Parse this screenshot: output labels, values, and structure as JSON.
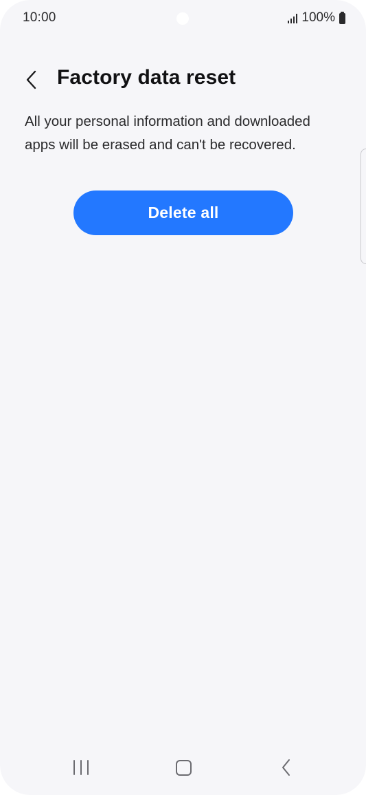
{
  "status_bar": {
    "time": "10:00",
    "battery": "100%"
  },
  "header": {
    "title": "Factory data reset",
    "back_icon": "chevron-left-icon"
  },
  "content": {
    "description": "All your personal information and downloaded apps will be erased and can't be recovered.",
    "delete_button_label": "Delete all"
  },
  "nav_bar": {
    "recents_icon": "recents-icon",
    "home_icon": "home-icon",
    "back_icon": "back-icon"
  },
  "colors": {
    "background": "#f6f6f9",
    "accent": "#2378ff",
    "text": "#111113"
  }
}
